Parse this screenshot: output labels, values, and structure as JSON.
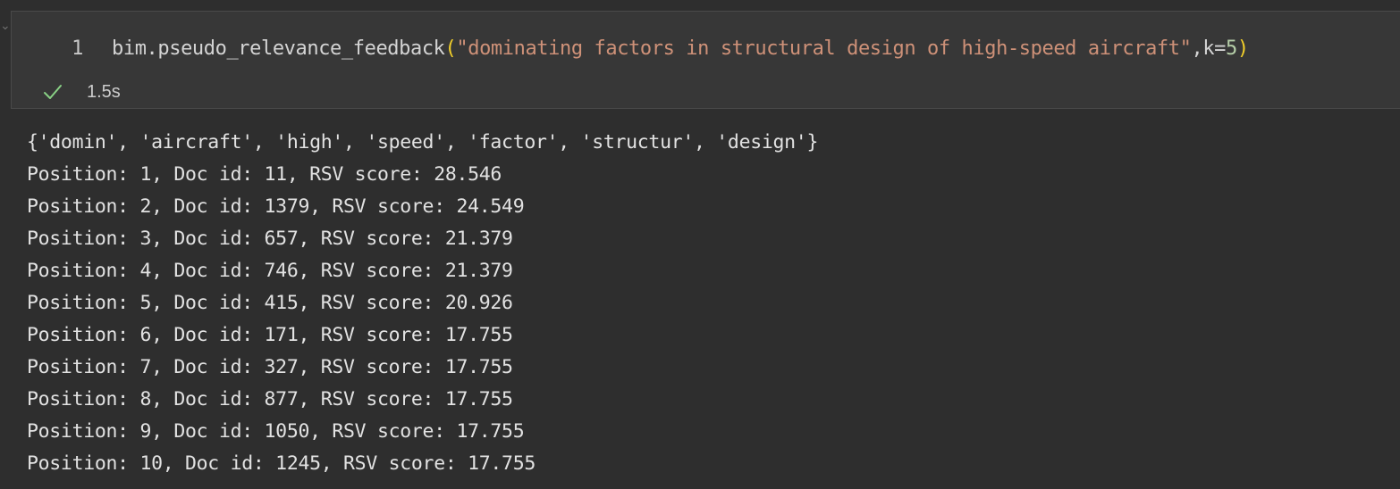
{
  "cell": {
    "line_number": "1",
    "code": {
      "prefix": "bim.pseudo_relevance_feedback",
      "open_paren": "(",
      "query_string": "\"dominating factors in structural design of high-speed aircraft\"",
      "separator": ",k=",
      "k_value": "5",
      "close_paren": ")"
    },
    "status_icon": "check-icon",
    "execution_time": "1.5s",
    "corner_glyph": "✓"
  },
  "output": {
    "lines": [
      "{'domin', 'aircraft', 'high', 'speed', 'factor', 'structur', 'design'}",
      "Position: 1, Doc id: 11, RSV score: 28.546",
      "Position: 2, Doc id: 1379, RSV score: 24.549",
      "Position: 3, Doc id: 657, RSV score: 21.379",
      "Position: 4, Doc id: 746, RSV score: 21.379",
      "Position: 5, Doc id: 415, RSV score: 20.926",
      "Position: 6, Doc id: 171, RSV score: 17.755",
      "Position: 7, Doc id: 327, RSV score: 17.755",
      "Position: 8, Doc id: 877, RSV score: 17.755",
      "Position: 9, Doc id: 1050, RSV score: 17.755",
      "Position: 10, Doc id: 1245, RSV score: 17.755"
    ]
  },
  "colors": {
    "background": "#2e2e2e",
    "cell_background": "#373737",
    "string": "#ce9178",
    "paren": "#f2cf2a",
    "number": "#b5cea8",
    "success": "#89d185"
  }
}
